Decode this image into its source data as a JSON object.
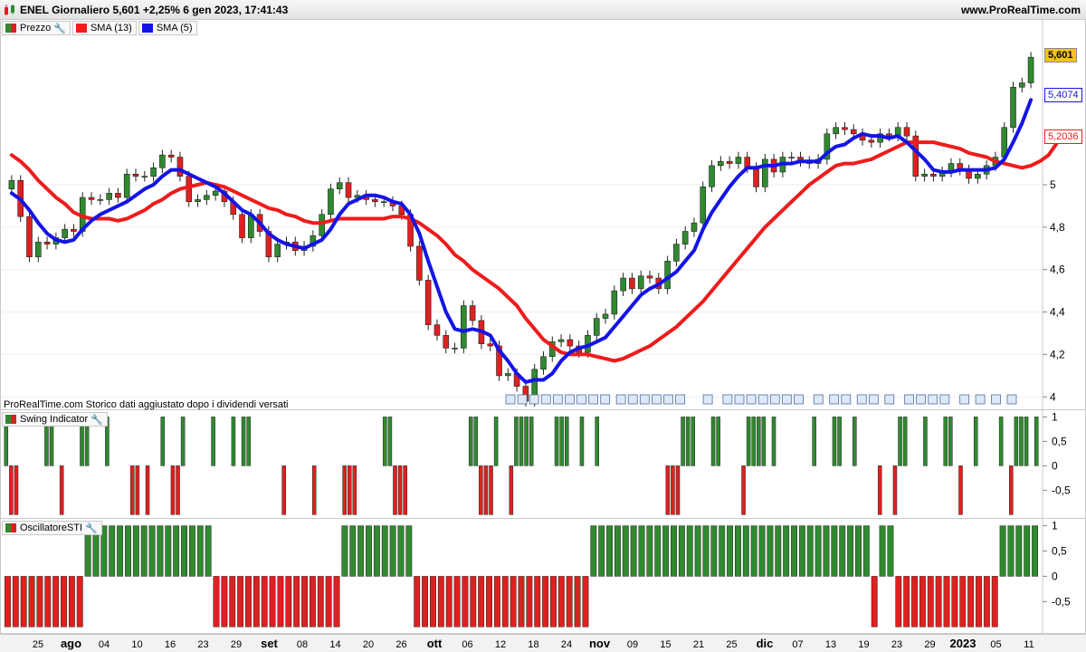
{
  "window": {
    "title": "ENEL Giornaliero 5,601 +2,25% 6 gen 2023, 17:41:43",
    "site": "www.ProRealTime.com"
  },
  "legend": {
    "price": "Prezzo",
    "sma13": "SMA (13)",
    "sma5": "SMA (5)"
  },
  "note": "ProRealTime.com  Storico dati aggiustato dopo i dividendi versati",
  "colors": {
    "up": "#2f8a2f",
    "down": "#e02020",
    "sma13": "#ee1c1c",
    "sma5": "#1414e6",
    "last": "#f4c21c"
  },
  "price_tags": {
    "last": "5,601",
    "sma5": "5,4074",
    "sma13": "5,2036"
  },
  "chart_data": [
    {
      "type": "candlestick",
      "name": "Prezzo",
      "ylim": [
        3.95,
        5.7
      ],
      "yticks": [
        4,
        4.2,
        4.4,
        4.6,
        4.8,
        5
      ],
      "ytick_labels": [
        "4",
        "4,2",
        "4,4",
        "4,6",
        "4,8",
        "5"
      ],
      "xtick_labels": [
        "25",
        "ago",
        "04",
        "10",
        "16",
        "23",
        "29",
        "set",
        "08",
        "14",
        "20",
        "26",
        "ott",
        "06",
        "12",
        "18",
        "24",
        "nov",
        "09",
        "15",
        "21",
        "25",
        "dic",
        "07",
        "13",
        "19",
        "23",
        "29",
        "2023",
        "05",
        "11"
      ],
      "close": [
        5.02,
        4.85,
        4.66,
        4.73,
        4.72,
        4.75,
        4.79,
        4.78,
        4.94,
        4.93,
        4.93,
        4.96,
        4.94,
        5.05,
        5.04,
        5.04,
        5.08,
        5.14,
        5.13,
        5.04,
        4.92,
        4.93,
        4.95,
        4.97,
        4.92,
        4.86,
        4.75,
        4.86,
        4.78,
        4.66,
        4.72,
        4.73,
        4.69,
        4.71,
        4.76,
        4.86,
        4.98,
        5.01,
        4.94,
        4.95,
        4.93,
        4.92,
        4.92,
        4.9,
        4.86,
        4.71,
        4.55,
        4.34,
        4.29,
        4.23,
        4.23,
        4.43,
        4.36,
        4.25,
        4.24,
        4.1,
        4.11,
        4.05,
        3.98,
        4.13,
        4.19,
        4.26,
        4.27,
        4.24,
        4.21,
        4.29,
        4.37,
        4.39,
        4.5,
        4.56,
        4.51,
        4.57,
        4.56,
        4.51,
        4.64,
        4.72,
        4.78,
        4.82,
        4.99,
        5.09,
        5.11,
        5.1,
        5.13,
        5.08,
        4.99,
        5.12,
        5.06,
        5.13,
        5.13,
        5.11,
        5.1,
        5.12,
        5.24,
        5.27,
        5.26,
        5.24,
        5.21,
        5.2,
        5.24,
        5.23,
        5.27,
        5.23,
        5.04,
        5.05,
        5.04,
        5.06,
        5.1,
        5.07,
        5.03,
        5.05,
        5.09,
        5.13,
        5.27,
        5.46,
        5.48,
        5.601
      ]
    },
    {
      "type": "line",
      "name": "SMA (13)",
      "ylim": [
        3.95,
        5.7
      ],
      "values": [
        5.14,
        5.11,
        5.07,
        5.02,
        4.98,
        4.94,
        4.91,
        4.87,
        4.85,
        4.84,
        4.84,
        4.84,
        4.83,
        4.84,
        4.86,
        4.88,
        4.91,
        4.93,
        4.96,
        4.98,
        4.99,
        5.0,
        5.01,
        5.0,
        4.99,
        4.97,
        4.95,
        4.93,
        4.91,
        4.89,
        4.88,
        4.86,
        4.85,
        4.83,
        4.82,
        4.82,
        4.83,
        4.84,
        4.84,
        4.84,
        4.84,
        4.84,
        4.84,
        4.85,
        4.85,
        4.84,
        4.82,
        4.79,
        4.76,
        4.72,
        4.67,
        4.64,
        4.6,
        4.57,
        4.54,
        4.51,
        4.47,
        4.43,
        4.37,
        4.32,
        4.27,
        4.24,
        4.21,
        4.2,
        4.2,
        4.2,
        4.19,
        4.18,
        4.17,
        4.18,
        4.2,
        4.22,
        4.24,
        4.27,
        4.3,
        4.33,
        4.37,
        4.41,
        4.45,
        4.5,
        4.55,
        4.6,
        4.65,
        4.7,
        4.75,
        4.8,
        4.84,
        4.88,
        4.92,
        4.96,
        5.0,
        5.03,
        5.06,
        5.09,
        5.1,
        5.1,
        5.11,
        5.12,
        5.14,
        5.16,
        5.18,
        5.2,
        5.2,
        5.2,
        5.2,
        5.19,
        5.18,
        5.17,
        5.15,
        5.14,
        5.13,
        5.11,
        5.1,
        5.09,
        5.08,
        5.09,
        5.11,
        5.14,
        5.2
      ]
    },
    {
      "type": "line",
      "name": "SMA (5)",
      "ylim": [
        3.95,
        5.7
      ],
      "values": [
        4.96,
        4.93,
        4.88,
        4.82,
        4.77,
        4.74,
        4.73,
        4.74,
        4.79,
        4.83,
        4.86,
        4.88,
        4.9,
        4.92,
        4.95,
        4.98,
        5.0,
        5.04,
        5.07,
        5.07,
        5.05,
        5.03,
        5.01,
        4.99,
        4.96,
        4.92,
        4.88,
        4.86,
        4.82,
        4.77,
        4.74,
        4.72,
        4.71,
        4.7,
        4.72,
        4.74,
        4.79,
        4.86,
        4.91,
        4.93,
        4.95,
        4.95,
        4.94,
        4.92,
        4.91,
        4.86,
        4.77,
        4.64,
        4.52,
        4.4,
        4.32,
        4.31,
        4.32,
        4.31,
        4.29,
        4.22,
        4.17,
        4.11,
        4.07,
        4.08,
        4.08,
        4.11,
        4.17,
        4.21,
        4.23,
        4.24,
        4.26,
        4.28,
        4.33,
        4.38,
        4.43,
        4.48,
        4.51,
        4.53,
        4.56,
        4.59,
        4.64,
        4.69,
        4.79,
        4.87,
        4.93,
        4.99,
        5.04,
        5.08,
        5.08,
        5.09,
        5.09,
        5.1,
        5.1,
        5.11,
        5.11,
        5.11,
        5.15,
        5.18,
        5.19,
        5.22,
        5.24,
        5.23,
        5.23,
        5.22,
        5.23,
        5.2,
        5.16,
        5.12,
        5.07,
        5.06,
        5.06,
        5.07,
        5.07,
        5.07,
        5.07,
        5.08,
        5.12,
        5.2,
        5.29,
        5.4
      ]
    },
    {
      "type": "bar",
      "name": "Swing Indicator",
      "ylim": [
        -1.05,
        1.1
      ],
      "yticks": [
        1,
        0.5,
        0,
        -0.5
      ],
      "ytick_labels": [
        "1",
        "0,5",
        "0",
        "-0,5"
      ],
      "values": [
        1,
        -1,
        -1,
        0,
        0,
        0,
        0,
        0,
        1,
        1,
        0,
        -1,
        0,
        0,
        0,
        1,
        1,
        0,
        0,
        0,
        1,
        0,
        0,
        0,
        0,
        -1,
        -1,
        0,
        -1,
        0,
        0,
        1,
        0,
        -1,
        -1,
        1,
        0,
        0,
        0,
        0,
        0,
        1,
        0,
        0,
        0,
        1,
        0,
        1,
        1,
        0,
        0,
        0,
        0,
        0,
        0,
        -1,
        0,
        0,
        0,
        0,
        0,
        -1,
        0,
        0,
        0,
        0,
        0,
        -1,
        -1,
        -1,
        0,
        0,
        0,
        0,
        0,
        1,
        1,
        -1,
        -1,
        -1,
        0,
        0,
        0,
        0,
        0,
        0,
        0,
        0,
        0,
        0,
        0,
        0,
        1,
        1,
        -1,
        -1,
        -1,
        1,
        0,
        0,
        -1,
        1,
        1,
        1,
        1,
        0,
        0,
        0,
        0,
        1,
        1,
        1,
        0,
        0,
        1,
        0,
        0,
        1,
        0,
        0,
        0,
        0,
        0,
        0,
        0,
        0,
        0,
        0,
        0,
        0,
        0,
        -1,
        -1,
        -1,
        1,
        1,
        1,
        0,
        0,
        0,
        1,
        1,
        0,
        0,
        0,
        0,
        -1,
        1,
        1,
        1,
        1,
        0,
        1,
        0,
        0,
        0,
        0,
        0,
        0,
        0,
        1,
        0,
        0,
        0,
        1,
        1,
        0,
        0,
        1,
        0,
        0,
        0,
        0,
        -1,
        0,
        0,
        -1,
        1,
        1,
        0,
        0,
        0,
        1,
        0,
        0,
        0,
        1,
        1,
        0,
        -1,
        0,
        0,
        1,
        0,
        0,
        0,
        0,
        1,
        0,
        -1,
        1,
        1,
        1,
        0,
        1
      ]
    },
    {
      "type": "bar",
      "name": "OscillatoreSTI",
      "ylim": [
        -1.05,
        1.1
      ],
      "yticks": [
        1,
        0.5,
        0,
        -0.5
      ],
      "ytick_labels": [
        "1",
        "0,5",
        "0",
        "-0,5"
      ],
      "values": [
        -1,
        -1,
        -1,
        -1,
        -1,
        -1,
        -1,
        -1,
        -1,
        -1,
        1,
        1,
        1,
        1,
        1,
        1,
        1,
        1,
        1,
        1,
        1,
        1,
        1,
        1,
        1,
        1,
        -1,
        -1,
        -1,
        -1,
        -1,
        -1,
        -1,
        -1,
        -1,
        -1,
        -1,
        -1,
        -1,
        -1,
        -1,
        -1,
        1,
        1,
        1,
        1,
        1,
        1,
        1,
        1,
        1,
        -1,
        -1,
        -1,
        -1,
        -1,
        -1,
        -1,
        -1,
        -1,
        -1,
        -1,
        -1,
        -1,
        -1,
        -1,
        -1,
        -1,
        -1,
        -1,
        -1,
        -1,
        -1,
        1,
        1,
        1,
        1,
        1,
        1,
        1,
        1,
        1,
        1,
        1,
        1,
        1,
        1,
        1,
        1,
        1,
        1,
        1,
        1,
        1,
        1,
        1,
        1,
        1,
        1,
        1,
        1,
        1,
        1,
        1,
        1,
        1,
        1,
        1,
        -1,
        1,
        1,
        -1,
        -1,
        -1,
        -1,
        -1,
        -1,
        -1,
        -1,
        -1,
        -1,
        -1,
        -1,
        -1,
        1,
        1,
        1,
        1,
        1
      ]
    }
  ],
  "panes": {
    "swing_label": "Swing Indicator",
    "sti_label": "OscillatoreSTI"
  }
}
